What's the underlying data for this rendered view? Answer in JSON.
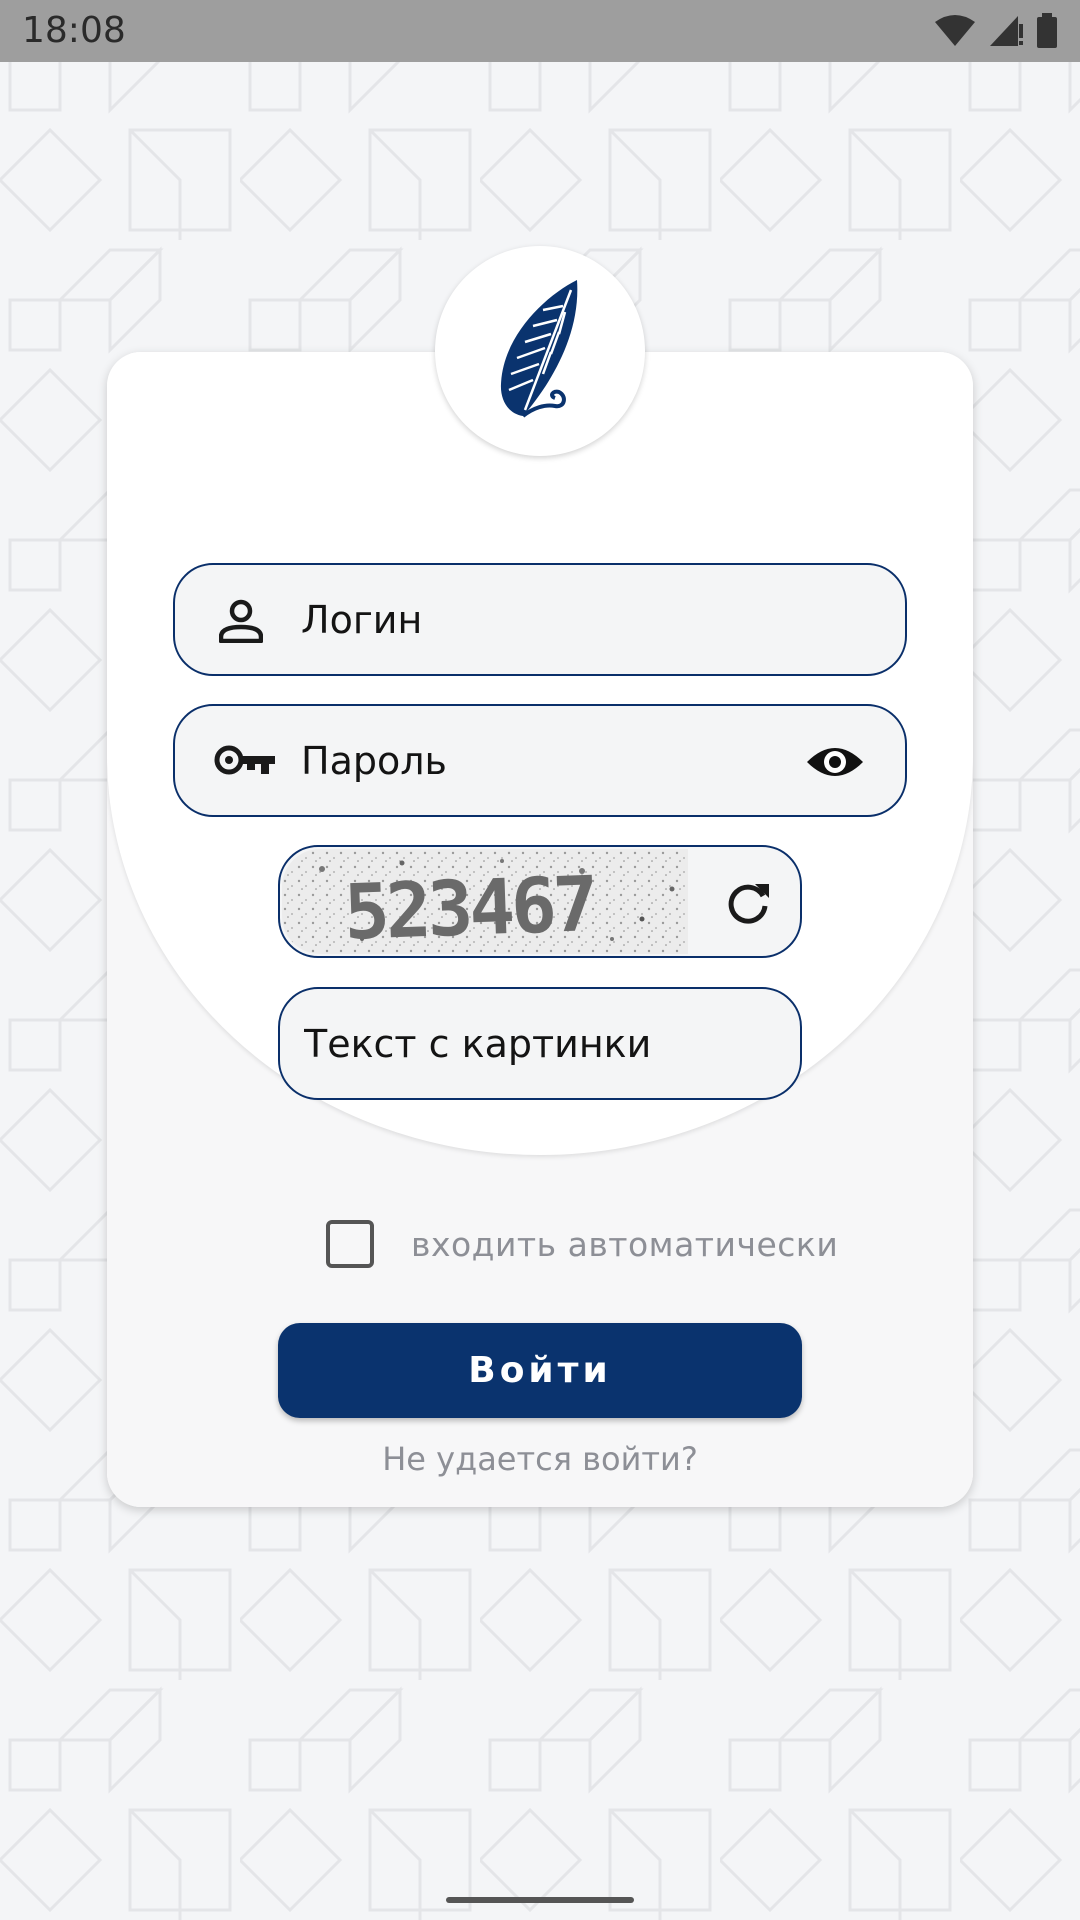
{
  "status_bar": {
    "time": "18:08",
    "icons": [
      "wifi-icon",
      "signal-icon",
      "battery-icon"
    ]
  },
  "logo": {
    "icon": "feather-logo-icon",
    "color": "#0a336e"
  },
  "form": {
    "login_placeholder": "Логин",
    "password_placeholder": "Пароль",
    "captcha_text": "523467",
    "captcha_input_placeholder": "Текст с картинки",
    "remember_label": "входить автоматически",
    "remember_checked": false,
    "submit_label": "Войти",
    "forgot_link": "Не удается войти?"
  },
  "colors": {
    "accent": "#0a336e",
    "field_border": "#0a2f6a",
    "muted_text": "#8d8f96"
  }
}
